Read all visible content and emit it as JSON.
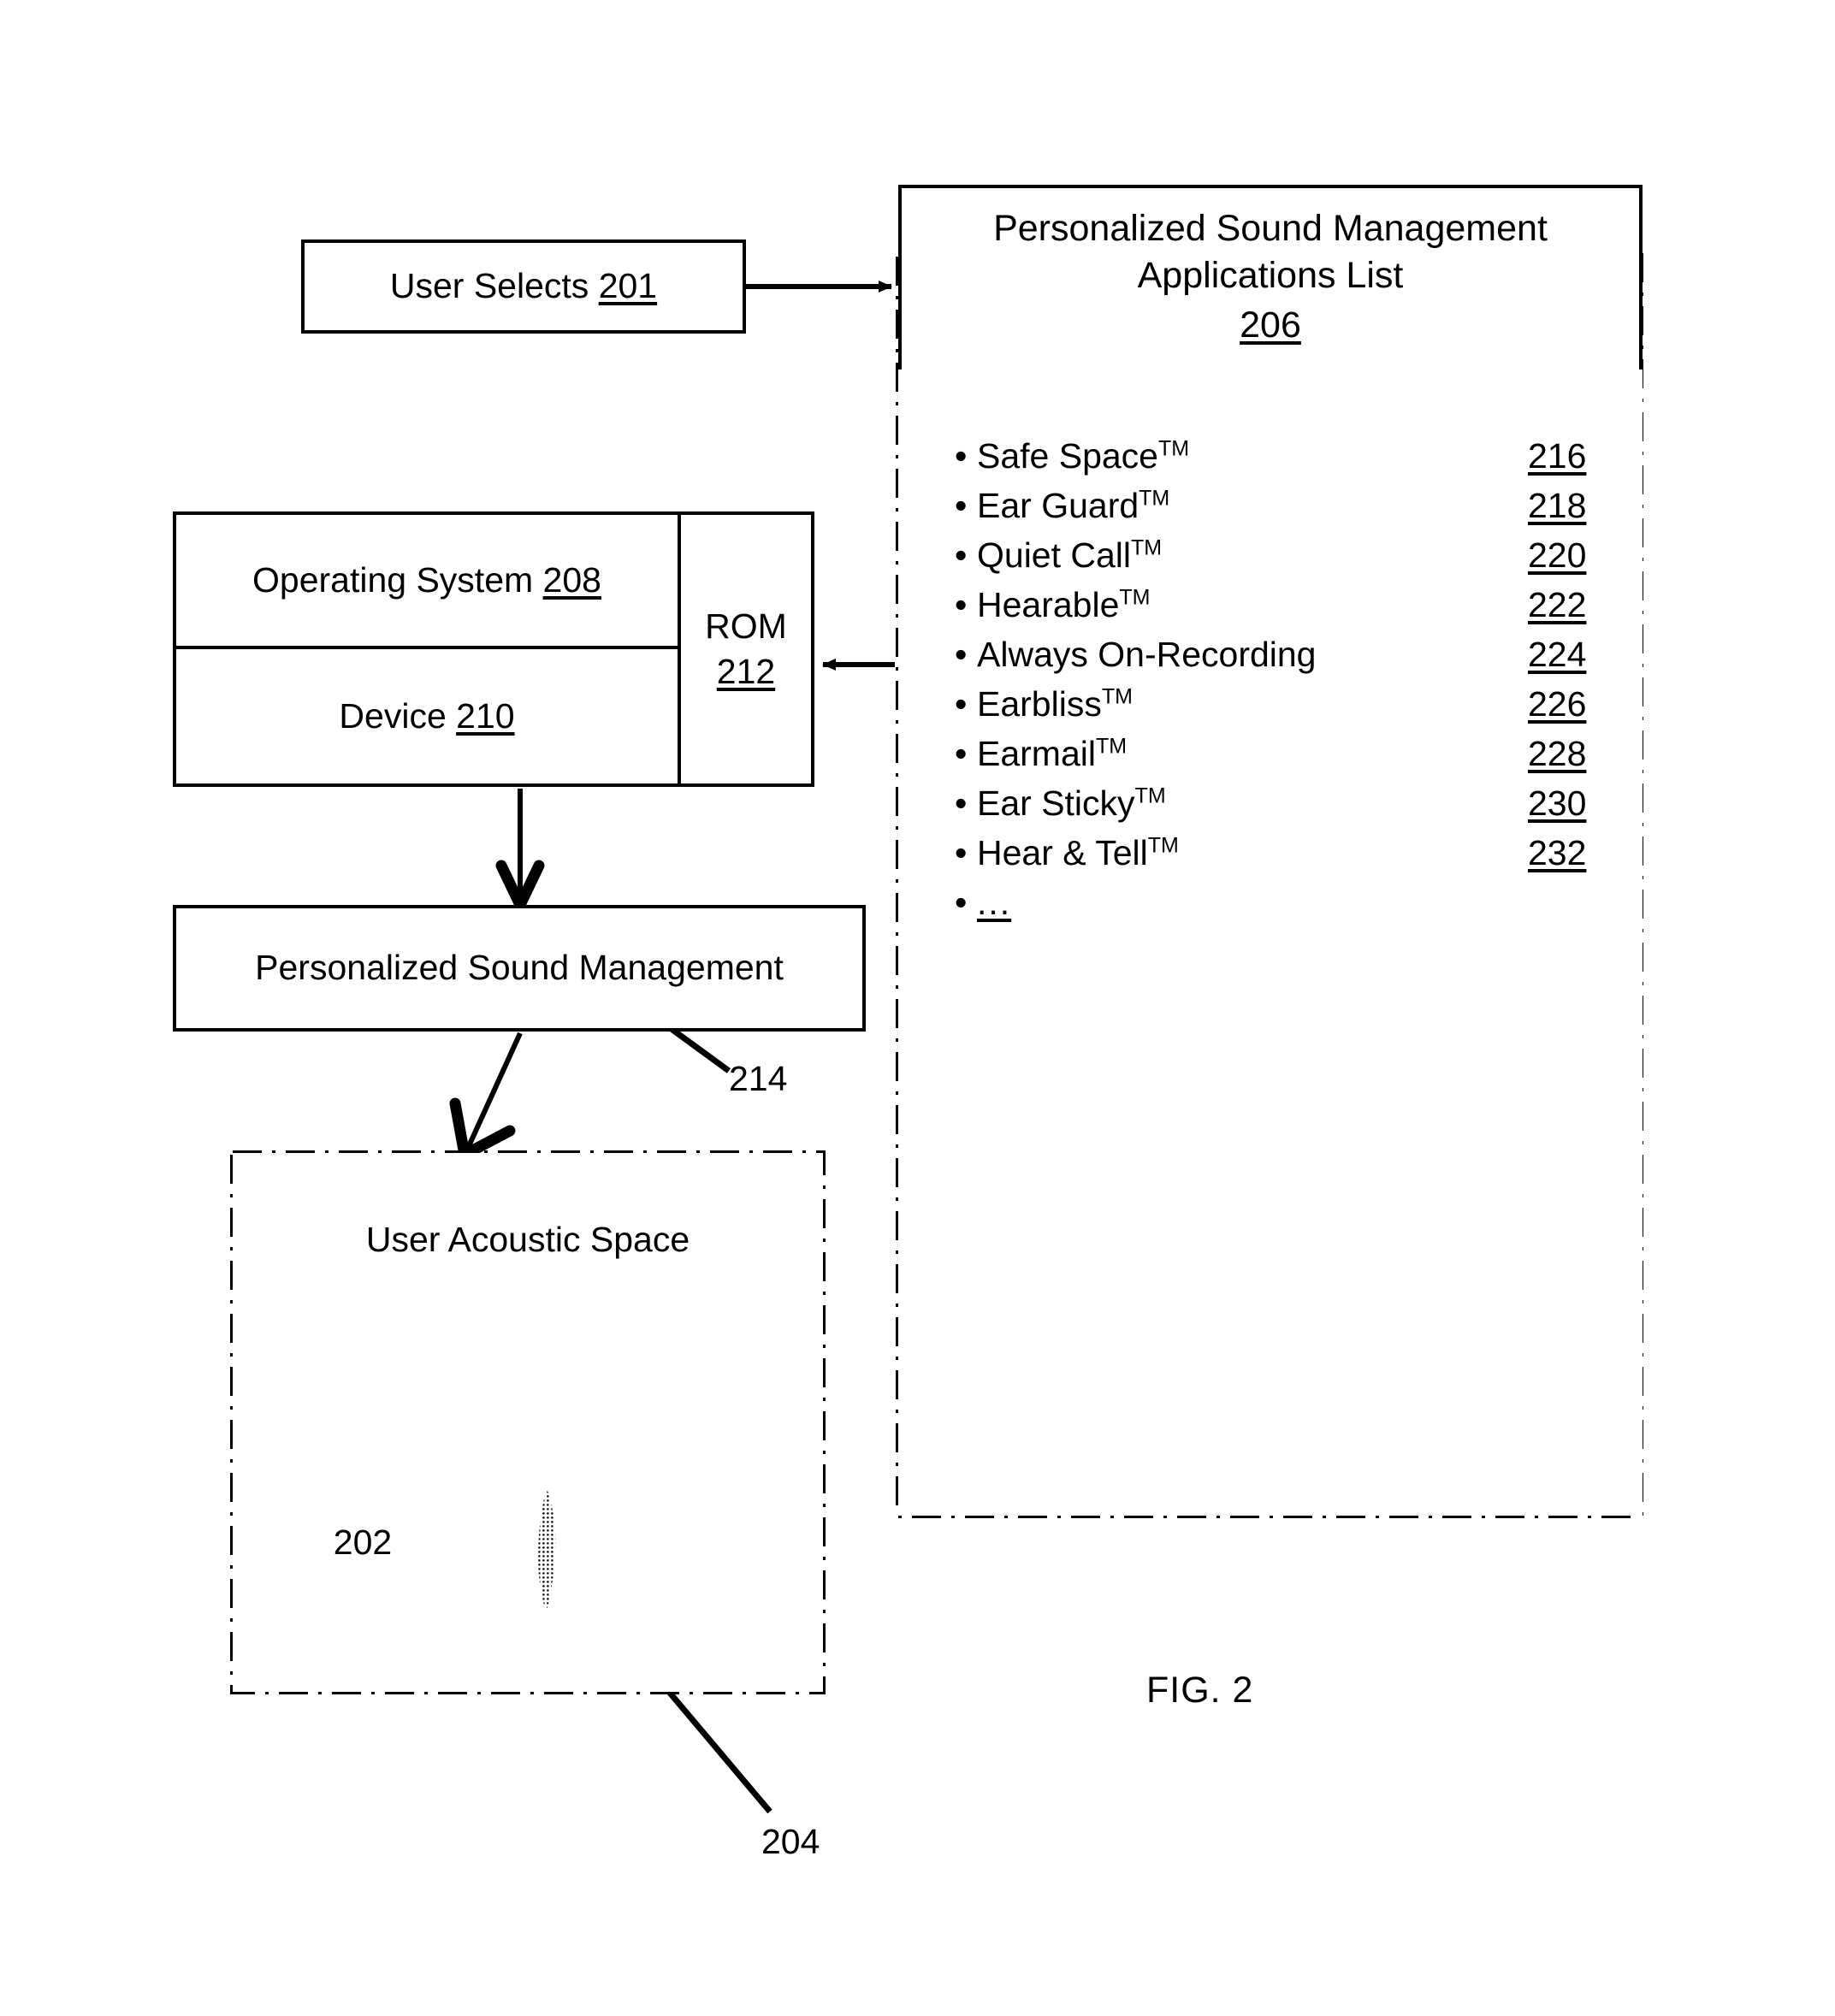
{
  "figure": {
    "caption": "FIG. 2"
  },
  "user_selects": {
    "label": "User Selects ",
    "ref": "201"
  },
  "system_block": {
    "operating_system": {
      "label": "Operating System ",
      "ref": "208"
    },
    "device": {
      "label": "Device ",
      "ref": "210"
    },
    "rom": {
      "label": "ROM",
      "ref": "212"
    }
  },
  "psm_box": {
    "label": "Personalized Sound Management",
    "leader_ref": "214"
  },
  "acoustic_space": {
    "label": "User Acoustic Space",
    "inner_ref": "202",
    "leader_ref": "204"
  },
  "apps_panel": {
    "header_line1": "Personalized Sound Management",
    "header_line2": "Applications List",
    "header_ref": "206",
    "bullet": "•",
    "items": [
      {
        "name": "Safe Space",
        "tm": "TM",
        "ref": "216"
      },
      {
        "name": "Ear Guard",
        "tm": "TM",
        "ref": "218"
      },
      {
        "name": "Quiet Call",
        "tm": "TM",
        "ref": "220"
      },
      {
        "name": "Hearable",
        "tm": "TM",
        "ref": "222"
      },
      {
        "name": "Always On-Recording",
        "tm": "",
        "ref": "224"
      },
      {
        "name": "Earbliss",
        "tm": "TM",
        "ref": "226"
      },
      {
        "name": "Earmail",
        "tm": "TM",
        "ref": "228"
      },
      {
        "name": "Ear Sticky",
        "tm": "TM",
        "ref": "230"
      },
      {
        "name": "Hear & Tell",
        "tm": "TM",
        "ref": "232"
      }
    ],
    "ellipsis_item": "..."
  },
  "colors": {
    "ink": "#000000",
    "paper": "#ffffff"
  }
}
